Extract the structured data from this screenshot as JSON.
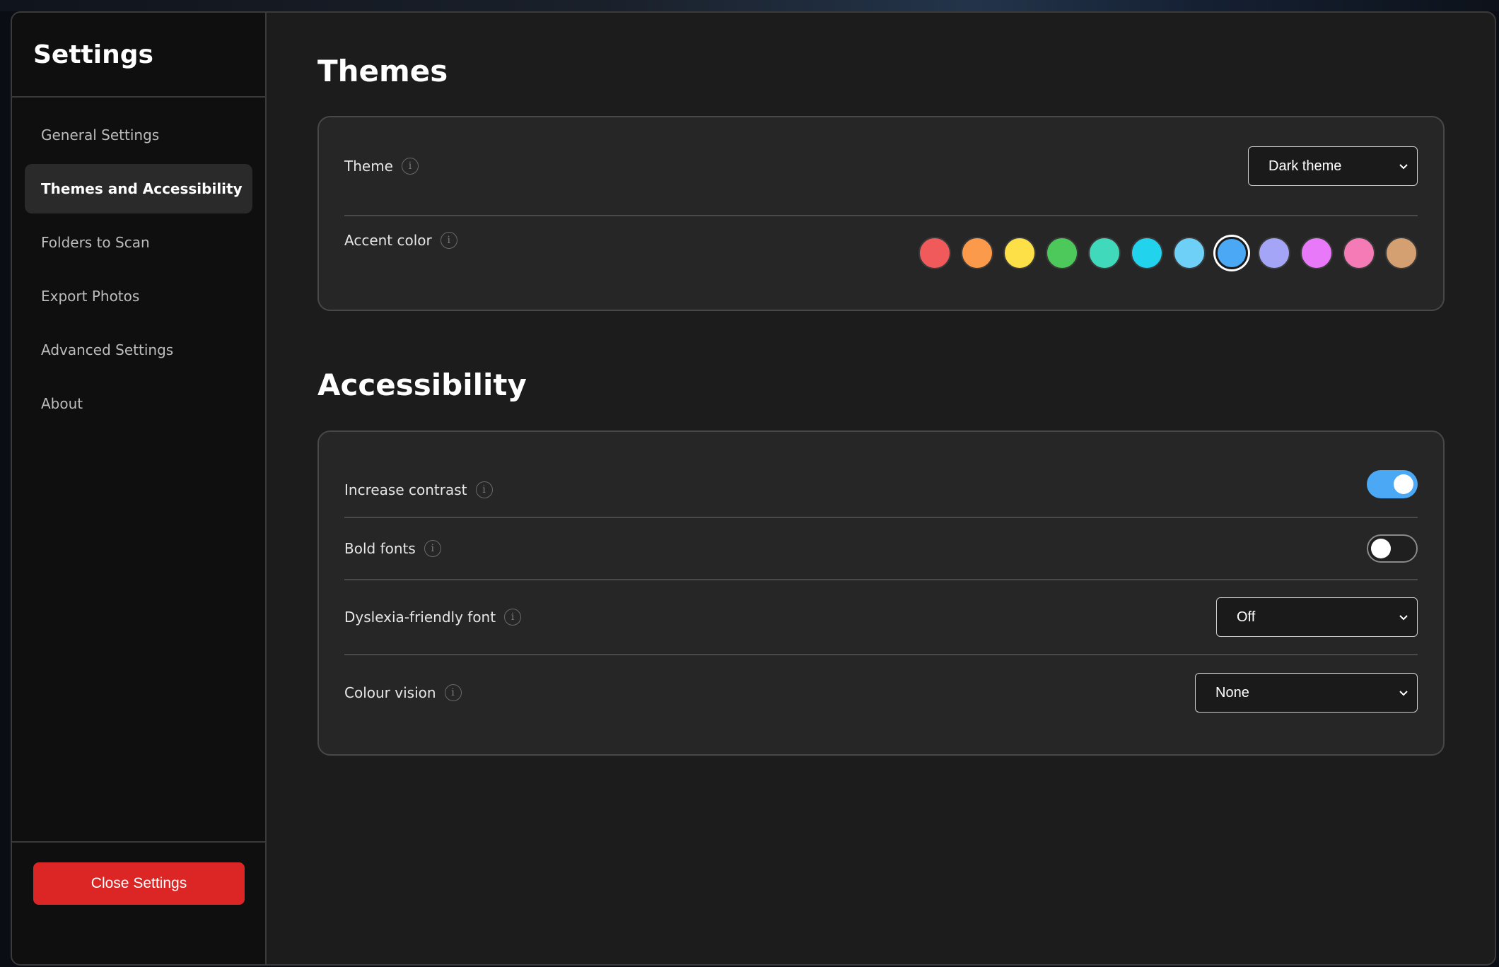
{
  "sidebar": {
    "title": "Settings",
    "items": [
      {
        "label": "General Settings",
        "active": false
      },
      {
        "label": "Themes and Accessibility",
        "active": true
      },
      {
        "label": "Folders to Scan",
        "active": false
      },
      {
        "label": "Export Photos",
        "active": false
      },
      {
        "label": "Advanced Settings",
        "active": false
      },
      {
        "label": "About",
        "active": false
      }
    ],
    "close_button": "Close Settings"
  },
  "themes": {
    "heading": "Themes",
    "theme_label": "Theme",
    "theme_value": "Dark theme",
    "accent_label": "Accent color",
    "accent_colors": [
      "#f15a5a",
      "#fb9a4a",
      "#fde047",
      "#4cc95a",
      "#40d9bb",
      "#22d3ee",
      "#6ed0f7",
      "#4aa8f5",
      "#a5a5f8",
      "#e879f9",
      "#f47bb6",
      "#d4a072"
    ],
    "accent_selected_index": 7
  },
  "accessibility": {
    "heading": "Accessibility",
    "increase_contrast_label": "Increase contrast",
    "increase_contrast_on": true,
    "bold_fonts_label": "Bold fonts",
    "bold_fonts_on": false,
    "dyslexia_label": "Dyslexia-friendly font",
    "dyslexia_value": "Off",
    "colour_vision_label": "Colour vision",
    "colour_vision_value": "None"
  },
  "icons": {
    "info": "i",
    "chevron": "chevron-down-icon"
  },
  "colors": {
    "close_button": "#dc2626",
    "toggle_on": "#4aa8f5"
  }
}
